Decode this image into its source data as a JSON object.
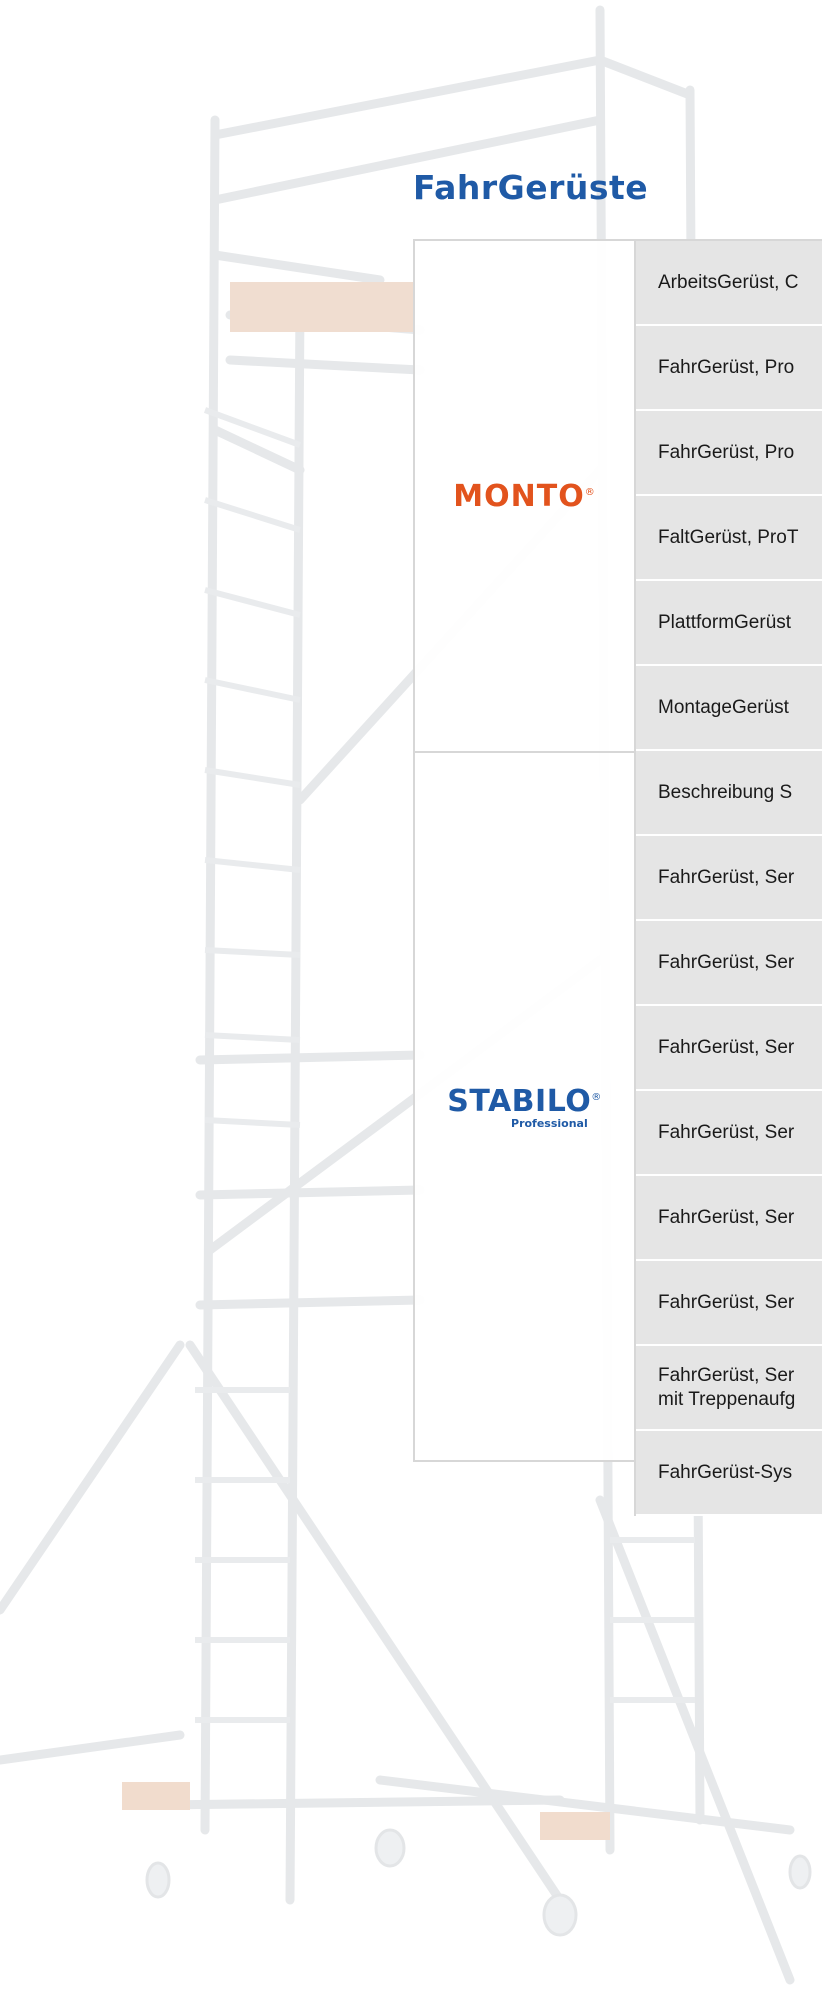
{
  "heading": "FahrGerüste",
  "brands": {
    "monto": {
      "name": "MONTO",
      "mark": "®"
    },
    "stabilo": {
      "name": "STABILO",
      "mark": "®",
      "sub": "Professional"
    }
  },
  "rows": [
    "ArbeitsGerüst, C",
    "FahrGerüst, Pro",
    "FahrGerüst, Pro",
    "FaltGerüst, ProT",
    "PlattformGerüst",
    "MontageGerüst",
    "Beschreibung S",
    "FahrGerüst, Ser",
    "FahrGerüst, Ser",
    "FahrGerüst, Ser",
    "FahrGerüst, Ser",
    "FahrGerüst, Ser",
    "FahrGerüst, Ser",
    "FahrGerüst, Ser\nmit Treppenaufg",
    "FahrGerüst-Sys"
  ]
}
